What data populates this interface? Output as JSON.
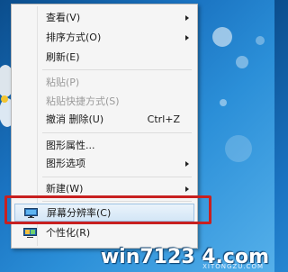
{
  "context_menu": {
    "items": [
      {
        "label": "查看(V)",
        "has_submenu": true,
        "disabled": false,
        "shortcut": ""
      },
      {
        "label": "排序方式(O)",
        "has_submenu": true,
        "disabled": false,
        "shortcut": ""
      },
      {
        "label": "刷新(E)",
        "has_submenu": false,
        "disabled": false,
        "shortcut": ""
      },
      {
        "label": "粘贴(P)",
        "has_submenu": false,
        "disabled": true,
        "shortcut": ""
      },
      {
        "label": "粘贴快捷方式(S)",
        "has_submenu": false,
        "disabled": true,
        "shortcut": ""
      },
      {
        "label": "撤消 删除(U)",
        "has_submenu": false,
        "disabled": false,
        "shortcut": "Ctrl+Z"
      },
      {
        "label": "图形属性...",
        "has_submenu": false,
        "disabled": false,
        "shortcut": ""
      },
      {
        "label": "图形选项",
        "has_submenu": true,
        "disabled": false,
        "shortcut": ""
      },
      {
        "label": "新建(W)",
        "has_submenu": true,
        "disabled": false,
        "shortcut": ""
      },
      {
        "label": "屏幕分辨率(C)",
        "has_submenu": false,
        "disabled": false,
        "shortcut": "",
        "icon": "monitor-icon",
        "selected": true
      },
      {
        "label": "个性化(R)",
        "has_submenu": false,
        "disabled": false,
        "shortcut": "",
        "icon": "personalize-icon"
      }
    ]
  },
  "watermark": {
    "text": "win7123 4.com",
    "sub": "XITONGZU.COM"
  },
  "colors": {
    "highlight_border": "#c82020",
    "selected_bg": "#d3e6f6",
    "desktop_blue": "#1a73c1"
  }
}
